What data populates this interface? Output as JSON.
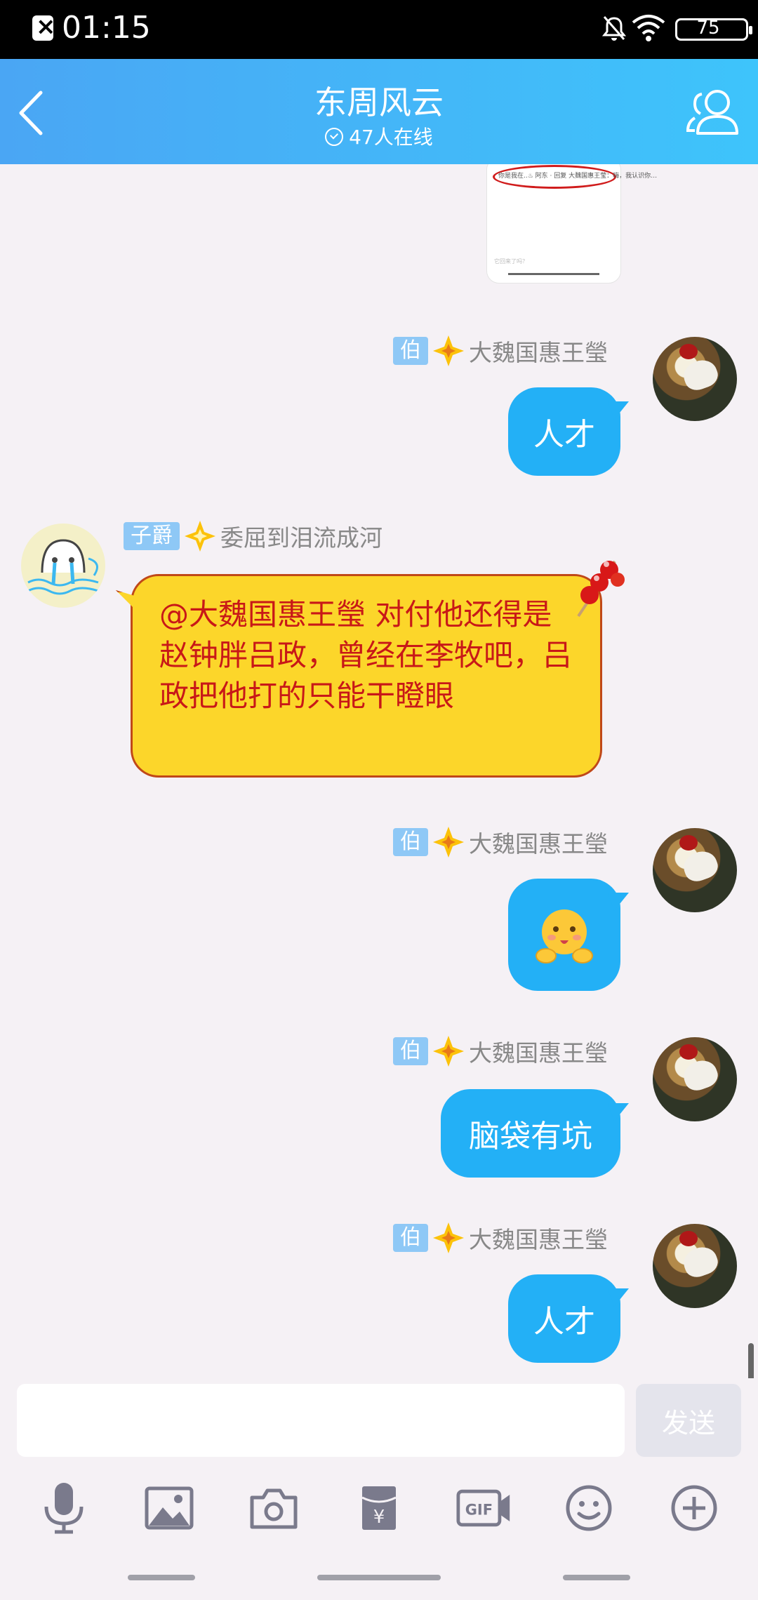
{
  "status_bar": {
    "time": "01:15",
    "battery": "75"
  },
  "header": {
    "title": "东周风云",
    "online": "47人在线"
  },
  "shared_image": {
    "strip_text": "你是我在..♨ 阿东 · 回复 大魏国惠王莹：嗨，我认识你…",
    "footer_text": "它回来了吗？"
  },
  "messages": [
    {
      "badge": "伯",
      "nick": "大魏国惠王瑩",
      "text": "人才"
    },
    {
      "badge": "子爵",
      "nick": "委屈到泪流成河",
      "text": "@大魏国惠王瑩 对付他还得是赵钟胖吕政，曾经在李牧吧，吕政把他打的只能干瞪眼"
    },
    {
      "badge": "伯",
      "nick": "大魏国惠王瑩",
      "text": ""
    },
    {
      "badge": "伯",
      "nick": "大魏国惠王瑩",
      "text": "脑袋有坑"
    },
    {
      "badge": "伯",
      "nick": "大魏国惠王瑩",
      "text": "人才"
    }
  ],
  "input": {
    "placeholder": "",
    "send_label": "发送"
  },
  "toolbar": [
    "mic-icon",
    "image-icon",
    "camera-icon",
    "red-packet-icon",
    "gif-icon",
    "emoji-icon",
    "plus-icon"
  ],
  "colors": {
    "header": "#3ec4fb",
    "bubble": "#23b0f6",
    "yellow_bubble": "#fcd62a",
    "yellow_text": "#c81818"
  }
}
